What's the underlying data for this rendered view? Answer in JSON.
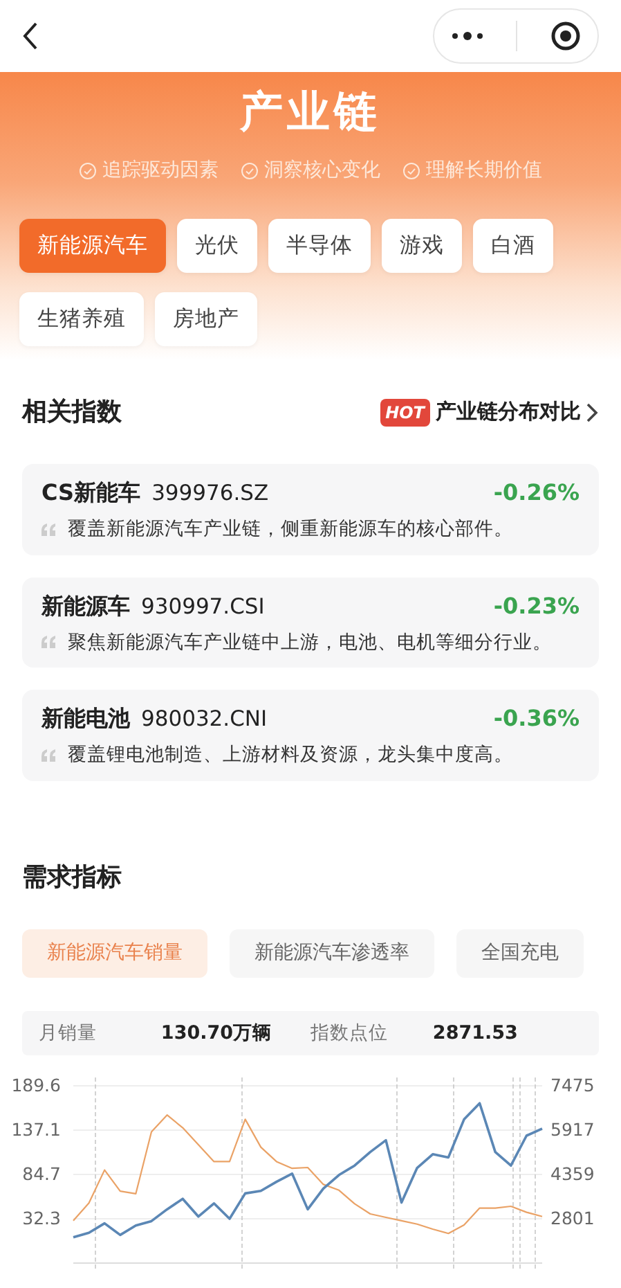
{
  "header": {
    "title": "产业链",
    "features": [
      "追踪驱动因素",
      "洞察核心变化",
      "理解长期价值"
    ]
  },
  "categories": [
    {
      "label": "新能源汽车",
      "selected": true
    },
    {
      "label": "光伏",
      "selected": false
    },
    {
      "label": "半导体",
      "selected": false
    },
    {
      "label": "游戏",
      "selected": false
    },
    {
      "label": "白酒",
      "selected": false
    },
    {
      "label": "生猪养殖",
      "selected": false
    },
    {
      "label": "房地产",
      "selected": false
    }
  ],
  "related": {
    "title": "相关指数",
    "hot_badge": "HOT",
    "link": "产业链分布对比",
    "items": [
      {
        "name": "CS新能车",
        "code": "399976.SZ",
        "change": "-0.26%",
        "description": "覆盖新能源汽车产业链，侧重新能源车的核心部件。"
      },
      {
        "name": "新能源车",
        "code": "930997.CSI",
        "change": "-0.23%",
        "description": "聚焦新能源汽车产业链中上游，电池、电机等细分行业。"
      },
      {
        "name": "新能电池",
        "code": "980032.CNI",
        "change": "-0.36%",
        "description": "覆盖锂电池制造、上游材料及资源，龙头集中度高。"
      }
    ]
  },
  "demand": {
    "title": "需求指标",
    "tabs": [
      {
        "label": "新能源汽车销量",
        "selected": true
      },
      {
        "label": "新能源汽车渗透率",
        "selected": false
      },
      {
        "label": "全国充电",
        "selected": false
      }
    ],
    "stats": [
      {
        "label": "月销量",
        "value": "130.70万辆"
      },
      {
        "label": "指数点位",
        "value": "2871.53"
      }
    ],
    "chart_data": {
      "type": "line",
      "grid": true,
      "ylim": [
        -20.1,
        189.6
      ],
      "y2lim": [
        1243,
        7475
      ],
      "yticks": [
        32.3,
        84.7,
        137.1,
        189.6
      ],
      "y2ticks": [
        2801,
        4359,
        5917,
        7475
      ],
      "series": [
        {
          "color": "#eaa266",
          "values": [
            30,
            51,
            90,
            65,
            62,
            135,
            155,
            140,
            120,
            100,
            100,
            150,
            117,
            100,
            92,
            93,
            73,
            66,
            50,
            38,
            34,
            30,
            26,
            20,
            15,
            25,
            45,
            45,
            47,
            40,
            35
          ]
        },
        {
          "color": "#5b87b5",
          "axis": "y2",
          "values": [
            2150,
            2310,
            2640,
            2230,
            2560,
            2720,
            3130,
            3500,
            2880,
            3340,
            2800,
            3690,
            3780,
            4100,
            4390,
            3130,
            3860,
            4340,
            4670,
            5150,
            5560,
            3370,
            4590,
            5070,
            4960,
            6290,
            6860,
            5150,
            4670,
            5720,
            5970
          ]
        }
      ]
    }
  }
}
